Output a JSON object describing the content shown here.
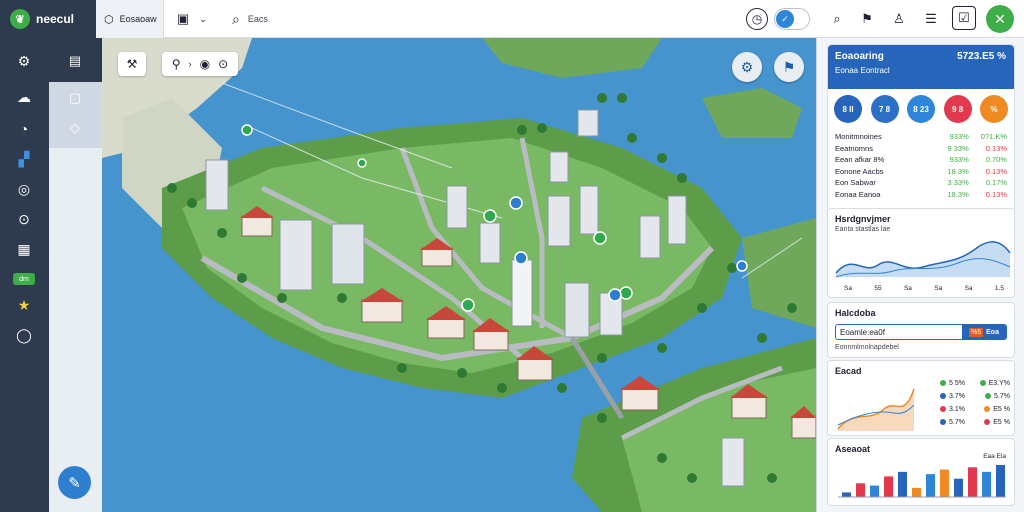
{
  "topbar": {
    "brand": "neecul",
    "tab_label": "Eosaoaw",
    "search_placeholder": "Eacs",
    "icons": [
      "timer-icon",
      "toggle-icon",
      "search-icon",
      "flag-icon",
      "user-icon",
      "menu-icon",
      "check-box-icon",
      "close-icon"
    ]
  },
  "rail": {
    "badge": "dm",
    "icons": [
      "settings-icon",
      "cloud-icon",
      "clock-icon",
      "chart-icon",
      "globe-icon",
      "timer-icon",
      "grid-icon",
      "star-icon",
      "chat-icon"
    ]
  },
  "map": {
    "toolbar_icons": [
      "tools-icon",
      "layers-icon",
      "pin-icon"
    ]
  },
  "panel": {
    "header": {
      "title": "Eoaoaring",
      "value": "5723.E5 %",
      "subtitle": "Eonaa Eontracl"
    },
    "circles": [
      {
        "label": "8 II",
        "color": "#2665b9"
      },
      {
        "label": "7 8",
        "color": "#2d6fc4"
      },
      {
        "label": "8 23",
        "color": "#2f86d8"
      },
      {
        "label": "9 8",
        "color": "#e2394f"
      },
      {
        "label": "%",
        "color": "#f08a22"
      }
    ],
    "stats": [
      {
        "label": "Monitmnoines",
        "v": "933%",
        "c": "0?1.K%"
      },
      {
        "label": "Eeatnomns",
        "v": "9 33%",
        "c": "0.13%"
      },
      {
        "label": "Eean afkar 8%",
        "v": "933%",
        "c": "0.70%"
      },
      {
        "label": "Eonone Aacbs",
        "v": "18.3%",
        "c": "0.13%"
      },
      {
        "label": "Eon Sabwar",
        "v": "3 33%",
        "c": "0.17%"
      },
      {
        "label": "Eonaa Eanoa",
        "v": "18.3%",
        "c": "0.13%"
      }
    ],
    "trend": {
      "title": "Hsrdgnvjmer",
      "subtitle": "Eanta stastlas lae",
      "ticks": [
        "Sa",
        "55",
        "Sa",
        "Sa",
        "Sa",
        "1.5"
      ]
    },
    "lookup": {
      "title": "Halcdoba",
      "query": "Eoamle:ea0f",
      "badge": "%5",
      "button": "Eoa",
      "caption": "Eonnmlmolnapdebel"
    },
    "metrics": {
      "title": "Eacad",
      "col1": [
        "5 5%",
        "3.7%",
        "3.1%",
        "5.7%"
      ],
      "col2": [
        "E3.Y%",
        "5.7%",
        "E5 %",
        "E5 %"
      ],
      "colors1": [
        "#3fae49",
        "#2665b9",
        "#e2394f",
        "#2665b9"
      ],
      "colors2": [
        "#3fae49",
        "#3fae49",
        "#f08a22",
        "#e2394f"
      ]
    },
    "bars": {
      "title": "Aseaoat",
      "legend": "Eaa Ela",
      "values": [
        2,
        6,
        5,
        9,
        11,
        4,
        10,
        12,
        8,
        13,
        11,
        14
      ]
    }
  }
}
